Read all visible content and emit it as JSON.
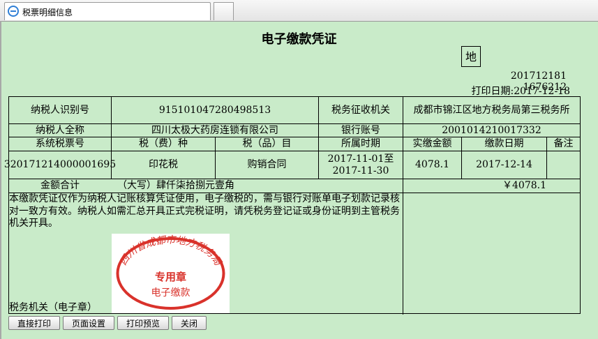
{
  "window": {
    "tab_title": "税票明细信息"
  },
  "doc": {
    "title": "电子缴款凭证",
    "di_label": "地",
    "serial": "201712181 1676212",
    "print_date": "打印日期:2017-12-18"
  },
  "table": {
    "taxpayer_id_label": "纳税人识别号",
    "taxpayer_id": "915101047280498513",
    "authority_label": "税务征收机关",
    "authority": "成都市锦江区地方税务局第三税务所",
    "taxpayer_name_label": "纳税人全称",
    "taxpayer_name": "四川太极大药房连锁有限公司",
    "bank_label": "银行账号",
    "bank_account": "2001014210017332",
    "headers": [
      "系统税票号",
      "税（费）种",
      "税（品）目",
      "所属时期",
      "实缴金额",
      "缴款日期",
      "备注"
    ],
    "row": {
      "ticket_no": "320171214000001695",
      "tax_type": "印花税",
      "tax_item": "购销合同",
      "period_from": "2017-11-01至",
      "period_to": "2017-11-30",
      "amount": "4078.1",
      "pay_date": "2017-12-14",
      "remark": ""
    },
    "total_label": "金额合计",
    "total_words": "（大写）肆仟柒拾捌元壹角",
    "total_amount": "￥4078.1"
  },
  "notice": "本缴款凭证仅作为纳税人记账核算凭证使用，电子缴税的，需与银行对账单电子划款记录核对一致方有效。纳税人如需汇总开具正式完税证明，请凭税务登记证或身份证明到主管税务机关开具。",
  "stamp": {
    "label": "税务机关（电子章）",
    "ring_text": "四川省成都市地方税务局",
    "seal_text": "专用章",
    "seal_sub": "电子缴款",
    "color": "#d9322b"
  },
  "buttons": {
    "print_direct": "直接打印",
    "page_setup": "页面设置",
    "print_preview": "打印预览",
    "close": "关闭"
  }
}
